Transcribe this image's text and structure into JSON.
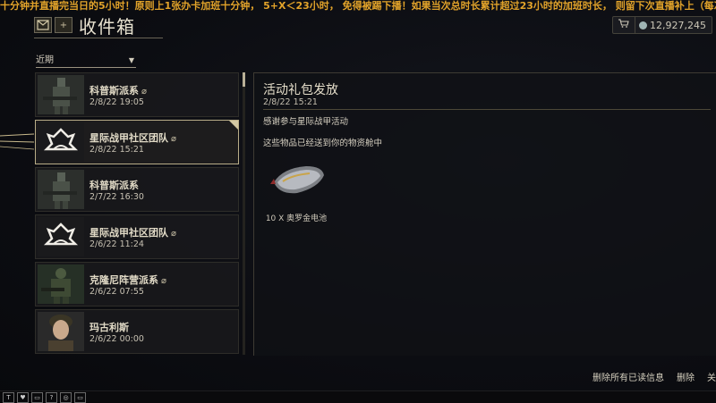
{
  "ticker": "十分钟并直播完当日的5小时！原则上1张办卡加班十分钟，  5+X＜23小时，  免得被踢下播！如果当次总时长累计超过23小时的加班时长，  则留下次直播补上（每次",
  "header": {
    "title": "收件箱",
    "credits": "12,927,245",
    "cart_icon": "cart-icon"
  },
  "filter": {
    "selected": "近期"
  },
  "messages": [
    {
      "sender": "科普斯派系",
      "date": "2/8/22 19:05",
      "attachment": true,
      "avatar": "corpus-soldier"
    },
    {
      "sender": "星际战甲社区团队",
      "date": "2/8/22 15:21",
      "attachment": true,
      "avatar": "lotus-emblem"
    },
    {
      "sender": "科普斯派系",
      "date": "2/7/22 16:30",
      "attachment": false,
      "avatar": "corpus-soldier"
    },
    {
      "sender": "星际战甲社区团队",
      "date": "2/6/22 11:24",
      "attachment": true,
      "avatar": "lotus-emblem"
    },
    {
      "sender": "克隆尼阵营派系",
      "date": "2/6/22 07:55",
      "attachment": true,
      "avatar": "grineer-soldier"
    },
    {
      "sender": "玛古利斯",
      "date": "2/6/22 00:00",
      "attachment": false,
      "avatar": "woman-portrait"
    }
  ],
  "detail": {
    "title": "活动礼包发放",
    "date": "2/8/22 15:21",
    "line1": "感谢参与星际战甲活动",
    "line2": "这些物品已经送到你的物资舱中",
    "attachment_label": "10 X 奥罗金电池"
  },
  "actions": {
    "delete_read": "删除所有已读信息",
    "delete": "删除",
    "close": "关"
  },
  "taskbar_icons": [
    "T",
    "♥",
    "▭",
    "?",
    "◎",
    "▭"
  ]
}
